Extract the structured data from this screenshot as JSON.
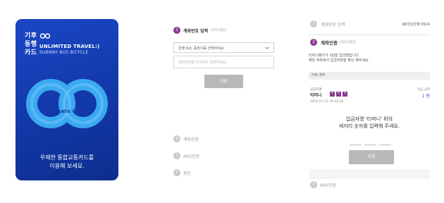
{
  "card": {
    "brand_line1": "기후",
    "brand_line2": "동행",
    "brand_line3": "카드",
    "tagline1": "UNLIMITED TRAVEL:)",
    "tagline2": "SUBWAY BUS BICYCLE",
    "mark_label": "Climate Card",
    "message_line1": "우제한 통합교통카드를",
    "message_line2": "이용해 보세요.",
    "colors": {
      "card_bg": "#1b47c6",
      "mark": "#3aa9f0"
    },
    "icon_small": "infinity-logo-icon",
    "icon_big": "infinity-mark-icon"
  },
  "middle": {
    "step1": {
      "number": "1",
      "title": "계좌번호 입력",
      "sub": "(최초1회만)"
    },
    "bank_select_text": "은행 또는 증권사를 선택하세요.",
    "account_placeholder": "계좌번호를 숫자로만 입력하세요.",
    "next_label": "다음",
    "step2": {
      "number": "2",
      "title": "계좌인증"
    },
    "step3": {
      "number": "3",
      "title": "ARS인증"
    },
    "step4": {
      "number": "4",
      "title": "확인"
    },
    "colors": {
      "active": "#8c3d8e",
      "inactive": "#c9c9c9",
      "button": "#b8b8b8"
    },
    "icon_chevron": "chevron-down-icon"
  },
  "right": {
    "step1": {
      "number": "1",
      "title": "계좌번호 입력",
      "bank": "KB국민은행 0624"
    },
    "step2": {
      "number": "2",
      "title": "계좌인증",
      "sub": "(최초1회만)"
    },
    "notice_line1": "티머니페이가 1원을 입금했습니다.",
    "notice_line2": "해당 계좌에서 입금자명을 확인 해주세요.",
    "table_header": "거래 내역",
    "depositor_label": "입금자명",
    "depositor_name": "티머니",
    "chips": [
      "*",
      "*",
      "*"
    ],
    "date": "2024.01.11 18:43:56",
    "amount_label": "입금 금액",
    "amount": "1 원",
    "prompt_line1": "입금자명 '티머니' 뒤의",
    "prompt_line2": "세자리 숫자를 입력해 주세요.",
    "next_label": "다음",
    "step3": {
      "number": "3",
      "title": "ARS인증"
    },
    "colors": {
      "amount": "#2a55d4"
    }
  }
}
